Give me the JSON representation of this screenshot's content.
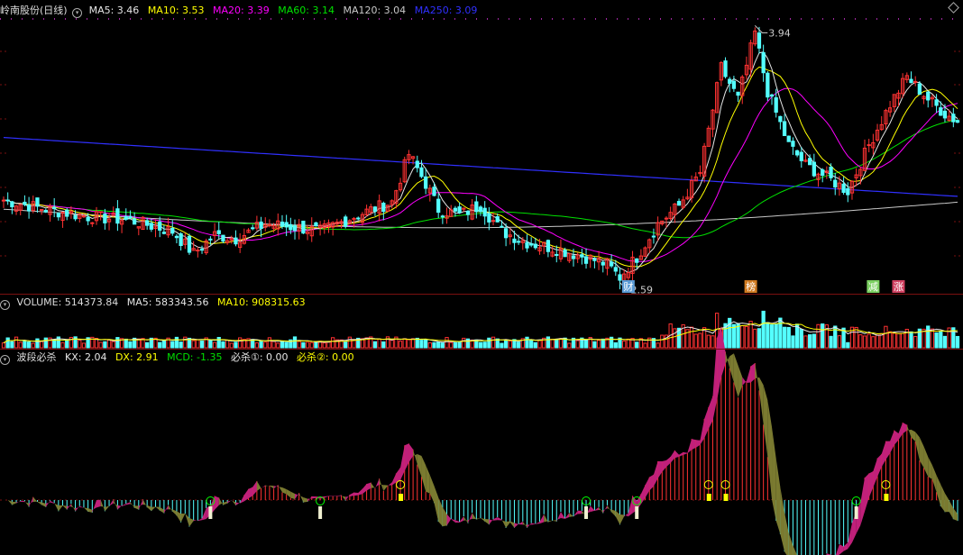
{
  "main_legend": {
    "stock": "岭南股份(日线)",
    "ma5": "MA5: 3.46",
    "ma10": "MA10: 3.53",
    "ma20": "MA20: 3.39",
    "ma60": "MA60: 3.14",
    "ma120": "MA120: 3.04",
    "ma250": "MA250: 3.09"
  },
  "vol_legend": {
    "volume": "VOLUME: 514373.84",
    "ma5": "MA5: 583343.56",
    "ma10": "MA10: 908315.63"
  },
  "ind_legend": {
    "name": "波段必杀",
    "kx": "KX: 2.04",
    "dx": "DX: 2.91",
    "mcd": "MCD: -1.35",
    "bs1": "必杀①: 0.00",
    "bs2": "必杀②: 0.00"
  },
  "colors": {
    "up": "#ff3232",
    "down": "#54ffff",
    "ma5": "#e6e6e6",
    "ma10": "#ffff00",
    "ma20": "#ff00ff",
    "ma60": "#00e000",
    "ma120": "#c8c8c8",
    "ma250": "#3030ff",
    "band_up": "#c0207a",
    "band_down": "#7a7a30"
  },
  "chart_data": [
    {
      "type": "candlestick",
      "title": "岭南股份(日线)",
      "annotations": {
        "high": "3.94",
        "low": "2.59"
      },
      "markers": [
        "财",
        "榜",
        "减",
        "涨"
      ],
      "anchors": [
        [
          0,
          3.03
        ],
        [
          10,
          2.98
        ],
        [
          20,
          2.94
        ],
        [
          30,
          2.92
        ],
        [
          40,
          2.86
        ],
        [
          45,
          2.74
        ],
        [
          50,
          2.84
        ],
        [
          55,
          2.82
        ],
        [
          62,
          2.9
        ],
        [
          70,
          2.88
        ],
        [
          75,
          2.86
        ],
        [
          84,
          2.95
        ],
        [
          92,
          3.02
        ],
        [
          96,
          3.28
        ],
        [
          100,
          3.12
        ],
        [
          103,
          2.98
        ],
        [
          108,
          2.95
        ],
        [
          113,
          3.0
        ],
        [
          118,
          2.86
        ],
        [
          124,
          2.8
        ],
        [
          130,
          2.77
        ],
        [
          138,
          2.72
        ],
        [
          143,
          2.68
        ],
        [
          146,
          2.61
        ],
        [
          150,
          2.72
        ],
        [
          155,
          2.9
        ],
        [
          160,
          3.0
        ],
        [
          165,
          3.18
        ],
        [
          170,
          3.75
        ],
        [
          174,
          3.58
        ],
        [
          178,
          3.94
        ],
        [
          181,
          3.62
        ],
        [
          186,
          3.33
        ],
        [
          190,
          3.22
        ],
        [
          196,
          3.14
        ],
        [
          200,
          3.08
        ],
        [
          205,
          3.33
        ],
        [
          210,
          3.55
        ],
        [
          214,
          3.7
        ],
        [
          219,
          3.58
        ],
        [
          223,
          3.5
        ],
        [
          226,
          3.46
        ]
      ],
      "ylim": [
        2.54,
        4.02
      ]
    },
    {
      "type": "bar",
      "title": "VOLUME",
      "series": [
        "VOLUME",
        "MA5",
        "MA10"
      ]
    },
    {
      "type": "area",
      "title": "波段必杀",
      "series": [
        "KX",
        "DX",
        "MCD",
        "必杀①",
        "必杀②"
      ]
    }
  ]
}
